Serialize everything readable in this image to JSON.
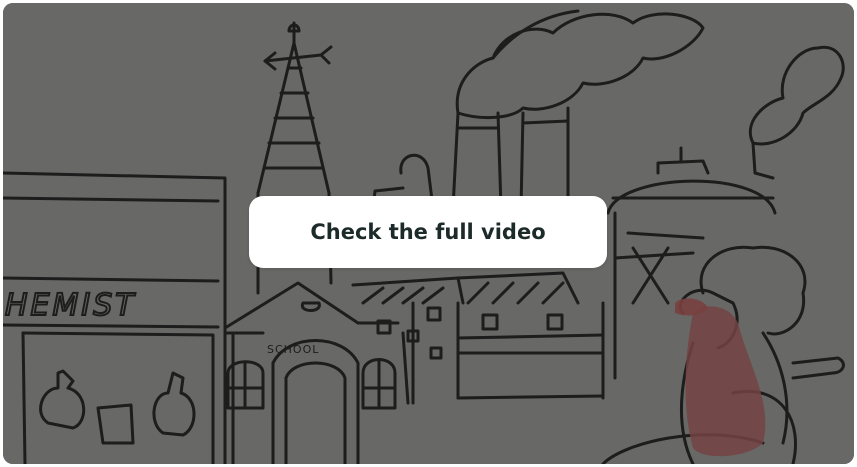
{
  "video": {
    "thumbnail": "drawing-of-town-with-chemist-school-church-factory",
    "sign_text": "HEMIST",
    "school_text": "SCHOOL"
  },
  "cta": {
    "label": "Check the full video"
  }
}
